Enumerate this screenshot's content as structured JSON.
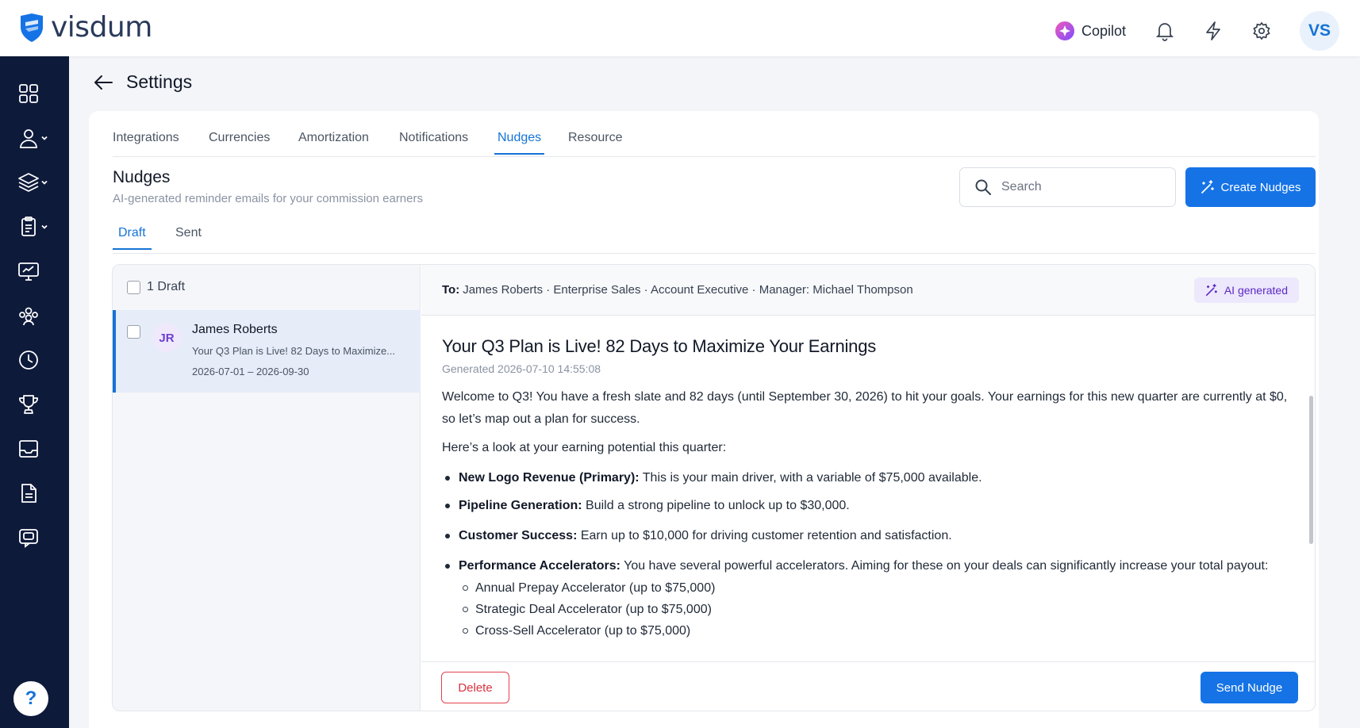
{
  "app": {
    "logo_text": "visdum"
  },
  "topbar": {
    "copilot_label": "Copilot",
    "user_initials": "VS",
    "icons": [
      "bell-icon",
      "bolt-icon",
      "gear-icon"
    ]
  },
  "header": {
    "title": "Settings"
  },
  "tabs": [
    {
      "label": "Integrations"
    },
    {
      "label": "Currencies"
    },
    {
      "label": "Amortization"
    },
    {
      "label": "Notifications"
    },
    {
      "label": "Nudges",
      "active": true
    },
    {
      "label": "Resource"
    }
  ],
  "section": {
    "title": "Nudges",
    "subtitle": "AI-generated reminder emails for your commission earners",
    "search_placeholder": "Search",
    "create_label": "Create Nudges"
  },
  "subtabs": [
    {
      "label": "Draft",
      "active": true
    },
    {
      "label": "Sent"
    }
  ],
  "list": {
    "header": "1 Draft",
    "items": [
      {
        "initials": "JR",
        "name": "James Roberts",
        "subject_preview": "Your Q3 Plan is Live! 82 Days to Maximize...",
        "period": "2026-07-01 – 2026-09-30"
      }
    ]
  },
  "detail": {
    "to_label": "To:",
    "to_value": "James Roberts · Enterprise Sales · Account Executive · Manager: Michael Thompson",
    "ai_badge": "AI generated",
    "subject": "Your Q3 Plan is Live! 82 Days to Maximize Your Earnings",
    "generated": "Generated 2026-07-10 14:55:08",
    "intro": "Welcome to Q3! You have a fresh slate and 82 days (until September 30, 2026) to hit your goals. Your earnings for this new quarter are currently at $0, so let’s map out a plan for success.",
    "lead": "Here’s a look at your earning potential this quarter:",
    "bullets": [
      {
        "bold": "New Logo Revenue (Primary):",
        "text": " This is your main driver, with a variable of $75,000 available."
      },
      {
        "bold": "Pipeline Generation:",
        "text": " Build a strong pipeline to unlock up to $30,000."
      },
      {
        "bold": "Customer Success:",
        "text": " Earn up to $10,000 for driving customer retention and satisfaction."
      },
      {
        "bold": "Performance Accelerators:",
        "text": " You have several powerful accelerators. Aiming for these on your deals can significantly increase your total payout:"
      }
    ],
    "sub_bullets": [
      "Annual Prepay Accelerator (up to $75,000)",
      "Strategic Deal Accelerator (up to $75,000)",
      "Cross-Sell Accelerator (up to $75,000)"
    ],
    "delete_label": "Delete",
    "send_label": "Send Nudge"
  },
  "colors": {
    "accent": "#1573e6",
    "sidebar": "#0e1a3a",
    "danger": "#d8323f",
    "ai": "#5a27c9"
  }
}
